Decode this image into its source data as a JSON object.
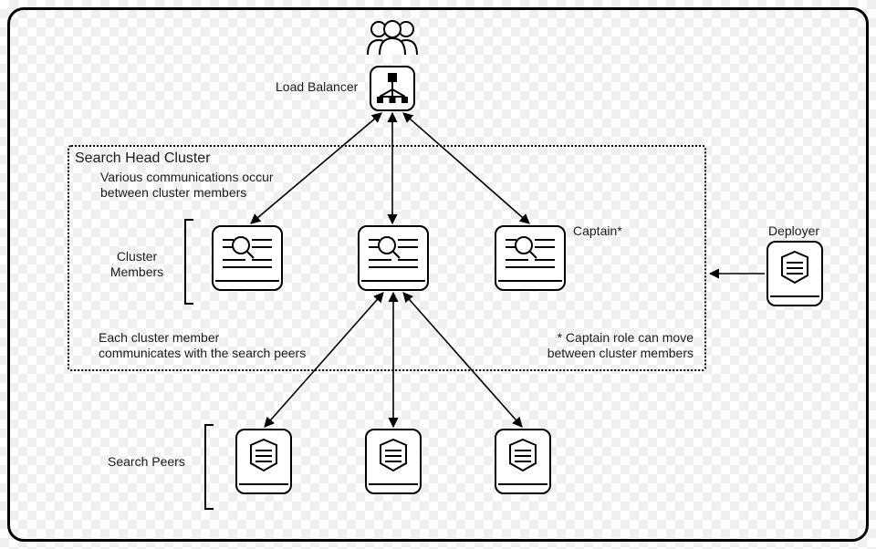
{
  "labels": {
    "load_balancer": "Load Balancer",
    "cluster_box_title": "Search Head Cluster",
    "comm_note": "Various communications occur\nbetween cluster members",
    "cluster_members": "Cluster\nMembers",
    "captain": "Captain*",
    "each_member_note": "Each cluster member\ncommunicates with the search peers",
    "captain_note": "* Captain role can move\nbetween cluster members",
    "deployer": "Deployer",
    "search_peers": "Search Peers"
  },
  "nodes": {
    "users_icon": "users",
    "load_balancer": "load-balancer",
    "cluster_member_1": "search-head",
    "cluster_member_2": "search-head",
    "cluster_member_3": "search-head",
    "deployer": "server",
    "search_peer_1": "server",
    "search_peer_2": "server",
    "search_peer_3": "server"
  }
}
